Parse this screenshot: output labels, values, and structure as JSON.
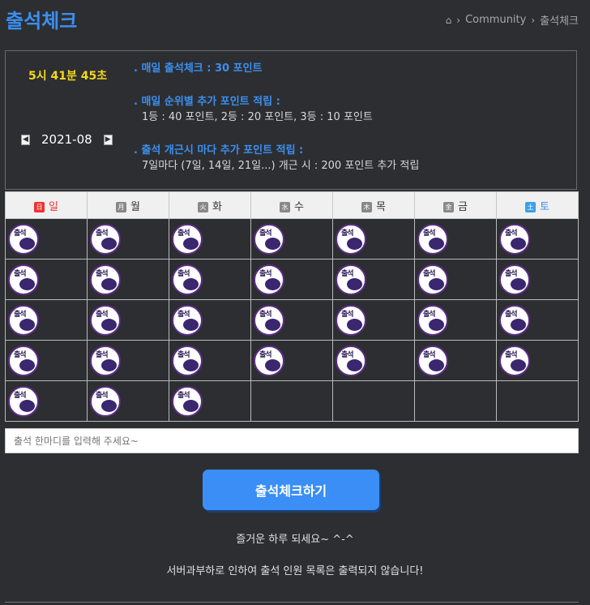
{
  "page": {
    "title": "출석체크"
  },
  "breadcrumb": {
    "home_icon": "home-icon",
    "items": [
      "Community",
      "출석체크"
    ]
  },
  "panel": {
    "clock": "5시 41분 45초",
    "month": "2021-08",
    "prev_icon": "chevron-left-icon",
    "next_icon": "chevron-right-icon",
    "info": [
      {
        "heading": ". 매일 출석체크 : 30 포인트",
        "detail": ""
      },
      {
        "heading": ". 매일 순위별 추가 포인트 적립 :",
        "detail": "1등 : 40 포인트,  2등 : 20 포인트,  3등 : 10 포인트"
      },
      {
        "heading": ". 출석 개근시 마다 추가 포인트 적립 :",
        "detail": "7일마다 (7일, 14일, 21일...) 개근 시 : 200 포인트 추가 적립"
      }
    ]
  },
  "calendar": {
    "days": [
      {
        "badge": "日",
        "label": "일",
        "type": "sun"
      },
      {
        "badge": "月",
        "label": "월",
        "type": "weekday"
      },
      {
        "badge": "火",
        "label": "화",
        "type": "weekday"
      },
      {
        "badge": "水",
        "label": "수",
        "type": "weekday"
      },
      {
        "badge": "木",
        "label": "목",
        "type": "weekday"
      },
      {
        "badge": "金",
        "label": "금",
        "type": "weekday"
      },
      {
        "badge": "土",
        "label": "토",
        "type": "sat"
      }
    ],
    "stamp_icon": "attendance-stamp-icon",
    "stamp_text": "출석",
    "stamp_count": 31,
    "rows": 5
  },
  "comment_input": {
    "placeholder": "출석 한마디를 입력해 주세요~"
  },
  "check_button": {
    "label": "출석체크하기"
  },
  "messages": {
    "greeting": "즐거운 하루 되세요~ ^-^",
    "notice": "서버과부하로 인하여 출석 인원 목록은 출력되지 않습니다!"
  },
  "colors": {
    "accent": "#3b8ff0",
    "clock": "#f3d81c",
    "background": "#2d2e31",
    "stamp_border": "#5b2d86"
  }
}
